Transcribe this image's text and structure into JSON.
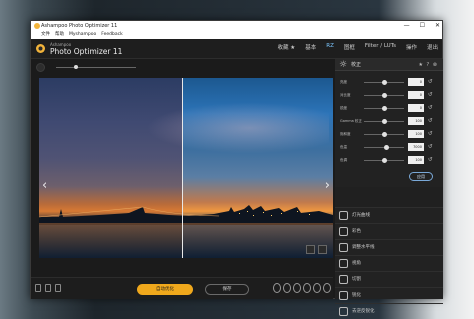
{
  "window": {
    "title": "Ashampoo Photo Optimizer 11",
    "controls": [
      "—",
      "☐",
      "✕"
    ]
  },
  "menu": {
    "items": [
      "文件",
      "帮助",
      "Myshampoo",
      "Feedback"
    ]
  },
  "app": {
    "brand_top": "Ashampoo",
    "brand": "Photo Optimizer 11",
    "nav": [
      {
        "label": "收藏 ★"
      },
      {
        "label": "基本"
      },
      {
        "label": "RZ",
        "active": true
      },
      {
        "label": "图框"
      },
      {
        "label": "Filter / LUTs"
      },
      {
        "label": "操作"
      },
      {
        "label": "退出"
      }
    ]
  },
  "zoom": {
    "level": 0.5
  },
  "panel": {
    "title": "校正",
    "head_icons": "★ ? ⊗",
    "adjustments": [
      {
        "label": "亮度",
        "value": "0",
        "level": 0.5
      },
      {
        "label": "对比度",
        "value": "0",
        "level": 0.5
      },
      {
        "label": "锐度",
        "value": "0",
        "level": 0.5
      },
      {
        "label": "Gamma 校正",
        "value": "100",
        "level": 0.5
      },
      {
        "label": "饱和度",
        "value": "100",
        "level": 0.5
      },
      {
        "label": "色温",
        "value": "7000",
        "level": 0.55
      },
      {
        "label": "色调",
        "value": "100",
        "level": 0.5
      }
    ],
    "apply": "应用",
    "modules": [
      {
        "label": "灯光曲线",
        "icon": "curve-icon"
      },
      {
        "label": "彩色",
        "icon": "color-icon"
      },
      {
        "label": "调整水平线",
        "icon": "horizon-icon"
      },
      {
        "label": "视角",
        "icon": "perspective-icon"
      },
      {
        "label": "切割",
        "icon": "crop-icon"
      },
      {
        "label": "锐化",
        "icon": "sharpen-icon"
      },
      {
        "label": "去逆反锐化",
        "icon": "unsharp-icon"
      }
    ]
  },
  "bottom": {
    "auto_label": "自动优化",
    "save_label": "保存"
  }
}
